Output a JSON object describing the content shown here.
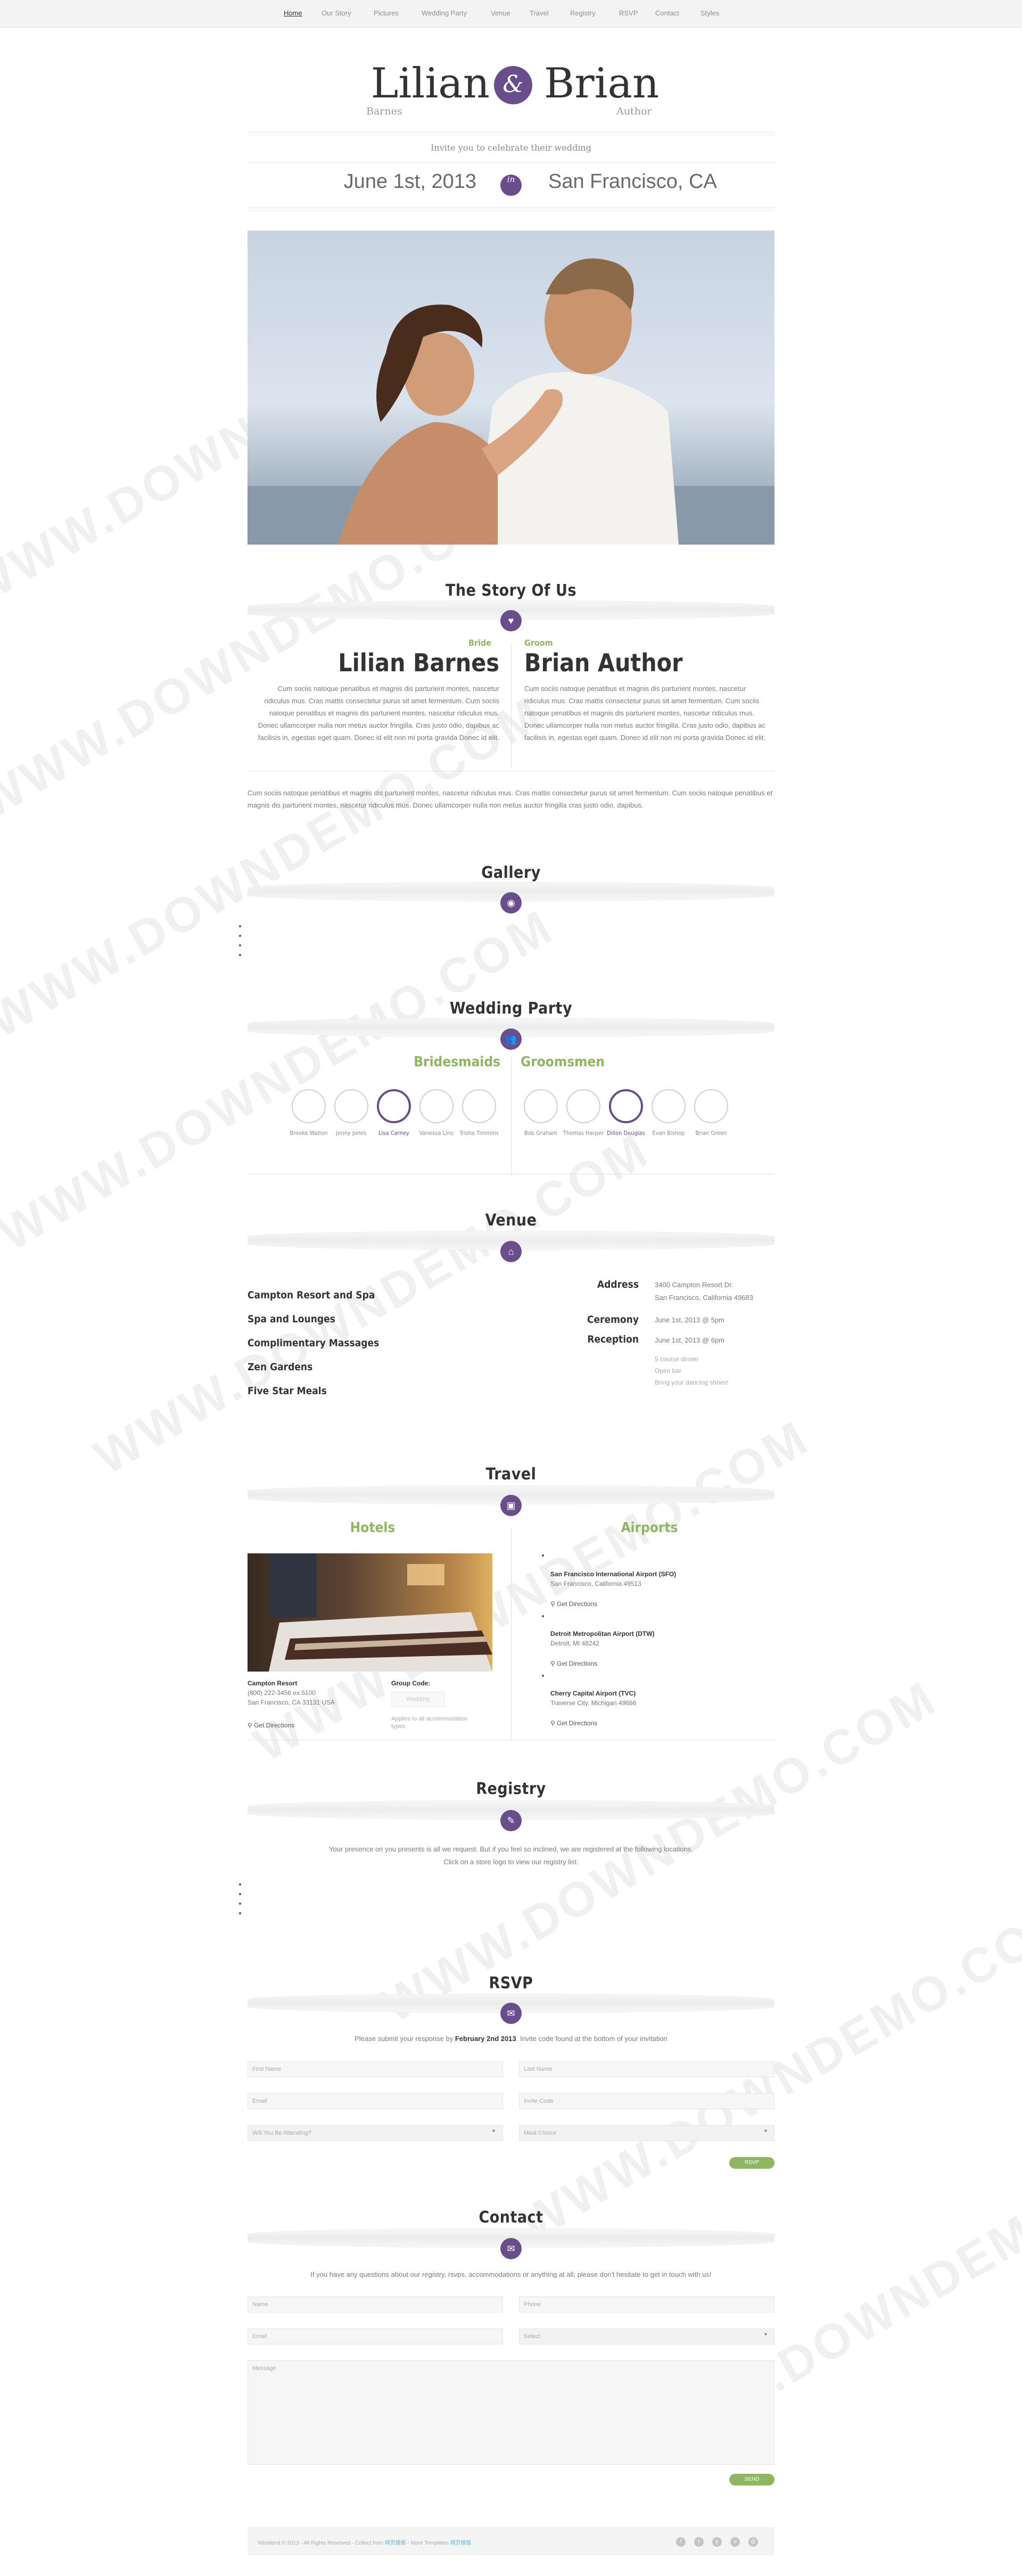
{
  "nav": [
    "Home",
    "Our Story",
    "Pictures",
    "Wedding Party",
    "Venue",
    "Travel",
    "Registry",
    "RSVP",
    "Contact",
    "Styles"
  ],
  "header": {
    "bride_first": "Lilian",
    "amp": "&",
    "groom_first": "Brian",
    "bride_last": "Barnes",
    "groom_last": "Author",
    "invite": "Invite you to celebrate their wedding",
    "date": "June 1st, 2013",
    "in": "in",
    "city": "San Francisco, CA"
  },
  "story": {
    "title": "The Story Of Us",
    "bride_role": "Bride",
    "groom_role": "Groom",
    "bride_name": "Lilian Barnes",
    "groom_name": "Brian Author",
    "bride_text": "Cum sociis natoque penatibus et magnis dis parturient montes, nascetur ridiculus mus. Cras mattis consectetur purus sit amet fermentum. Cum sociis natoque penatibus et magnis dis parturient montes, nascetur ridiculus mus. Donec ullamcorper nulla non metus auctor fringilla. Cras justo odio, dapibus ac facilisis in, egestas eget quam. Donec id elit non mi porta gravida Donec id elit.",
    "groom_text": "Cum sociis natoque penatibus et magnis dis parturient montes, nascetur ridiculus mus. Cras mattis consectetur purus sit amet fermentum. Cum sociis natoque penatibus et magnis dis parturient montes, nascetur ridiculus mus. Donec ullamcorper nulla non metus auctor fringilla. Cras justo odio, dapibus ac facilisis in, egestas eget quam. Donec id elit non mi porta gravida Donec id elit.",
    "full_text": "Cum sociis natoque penatibus et magnis dis parturient montes, nascetur ridiculus mus. Cras mattis consectetur purus sit amet fermentum. Cum sociis natoque penatibus et magnis dis parturient montes, nascetur ridiculus mus. Donec ullamcorper nulla non metus auctor fringilla cras justo odio, dapibus."
  },
  "gallery": {
    "title": "Gallery"
  },
  "party": {
    "title": "Wedding Party",
    "bridesmaids_label": "Bridesmaids",
    "groomsmen_label": "Groomsmen",
    "bridesmaids": [
      "Brooke Walton",
      "Jenny Jones",
      "Lisa Carney",
      "Vanessa Lino",
      "Trisha Timmins"
    ],
    "groomsmen": [
      "Bob Graham",
      "Thomas Harper",
      "Dillon Douglas",
      "Evan Bishop",
      "Brian Green"
    ]
  },
  "venue": {
    "title": "Venue",
    "features": [
      "Campton Resort and Spa",
      "Spa and Lounges",
      "Complimentary Massages",
      "Zen Gardens",
      "Five Star Meals"
    ],
    "address_label": "Address",
    "address_1": "3400 Campton Resort Dr.",
    "address_2": "San Francisco, California 49683",
    "ceremony_label": "Ceremony",
    "ceremony_val": "June 1st, 2013 @ 5pm",
    "reception_label": "Reception",
    "reception_val": "June 1st, 2013 @ 6pm",
    "reception_notes": [
      "5 course dinner",
      "Open bar",
      "Bring your dancing shoes!"
    ]
  },
  "travel": {
    "title": "Travel",
    "hotels_label": "Hotels",
    "airports_label": "Airports",
    "hotel_name": "Campton Resort",
    "hotel_phone": "(800) 222-3456 ex 5100",
    "hotel_city": "San Francisco, CA 33131 USA",
    "group_code_label": "Group Code:",
    "group_code": "Wedding",
    "group_note": "Applies to all accommodation types",
    "get_directions": "Get Directions",
    "airports": [
      {
        "name": "San Francisco International Airport (SFO)",
        "city": "San Francisco, California 49513"
      },
      {
        "name": "Detroit Metropolitan Airport (DTW)",
        "city": "Detroit, MI 48242"
      },
      {
        "name": "Cherry Capital Airport (TVC)",
        "city": "Traverse City, Michigan 49686"
      }
    ]
  },
  "registry": {
    "title": "Registry",
    "line1": "Your presence on you presents is all we request. But if you feel so inclined, we are registered at the following locations.",
    "line2": "Click on a store logo to view our registry list."
  },
  "rsvp": {
    "title": "RSVP",
    "intro_a": "Please submit your response by",
    "deadline": "February 2nd 2013",
    "intro_b": ". Invite code found at the bottom of your invitation",
    "first_name": "First Name",
    "last_name": "Last Name",
    "email": "Email",
    "invite_code": "Invite Code",
    "attending": "Will You Be Attending?",
    "meal": "Meal Choice",
    "button": "RSVP"
  },
  "contact": {
    "title": "Contact",
    "intro": "If you have any questions about our registry, rsvps, accommodations or anything at all, please don't hesitate to get in touch with us!",
    "name": "Name",
    "phone": "Phone",
    "email": "Email",
    "select": "Select",
    "message": "Message",
    "button": "SEND"
  },
  "footer": {
    "copyright": "Weddend © 2013 - All Rights Reserved - Collect from",
    "link1": "网页模板",
    "mid": "- More Templates",
    "link2": "网页模板"
  },
  "watermark": "WWW.DOWNDEMO.COM",
  "colors": {
    "accent": "#6a4d8c",
    "green": "#8fb761"
  }
}
